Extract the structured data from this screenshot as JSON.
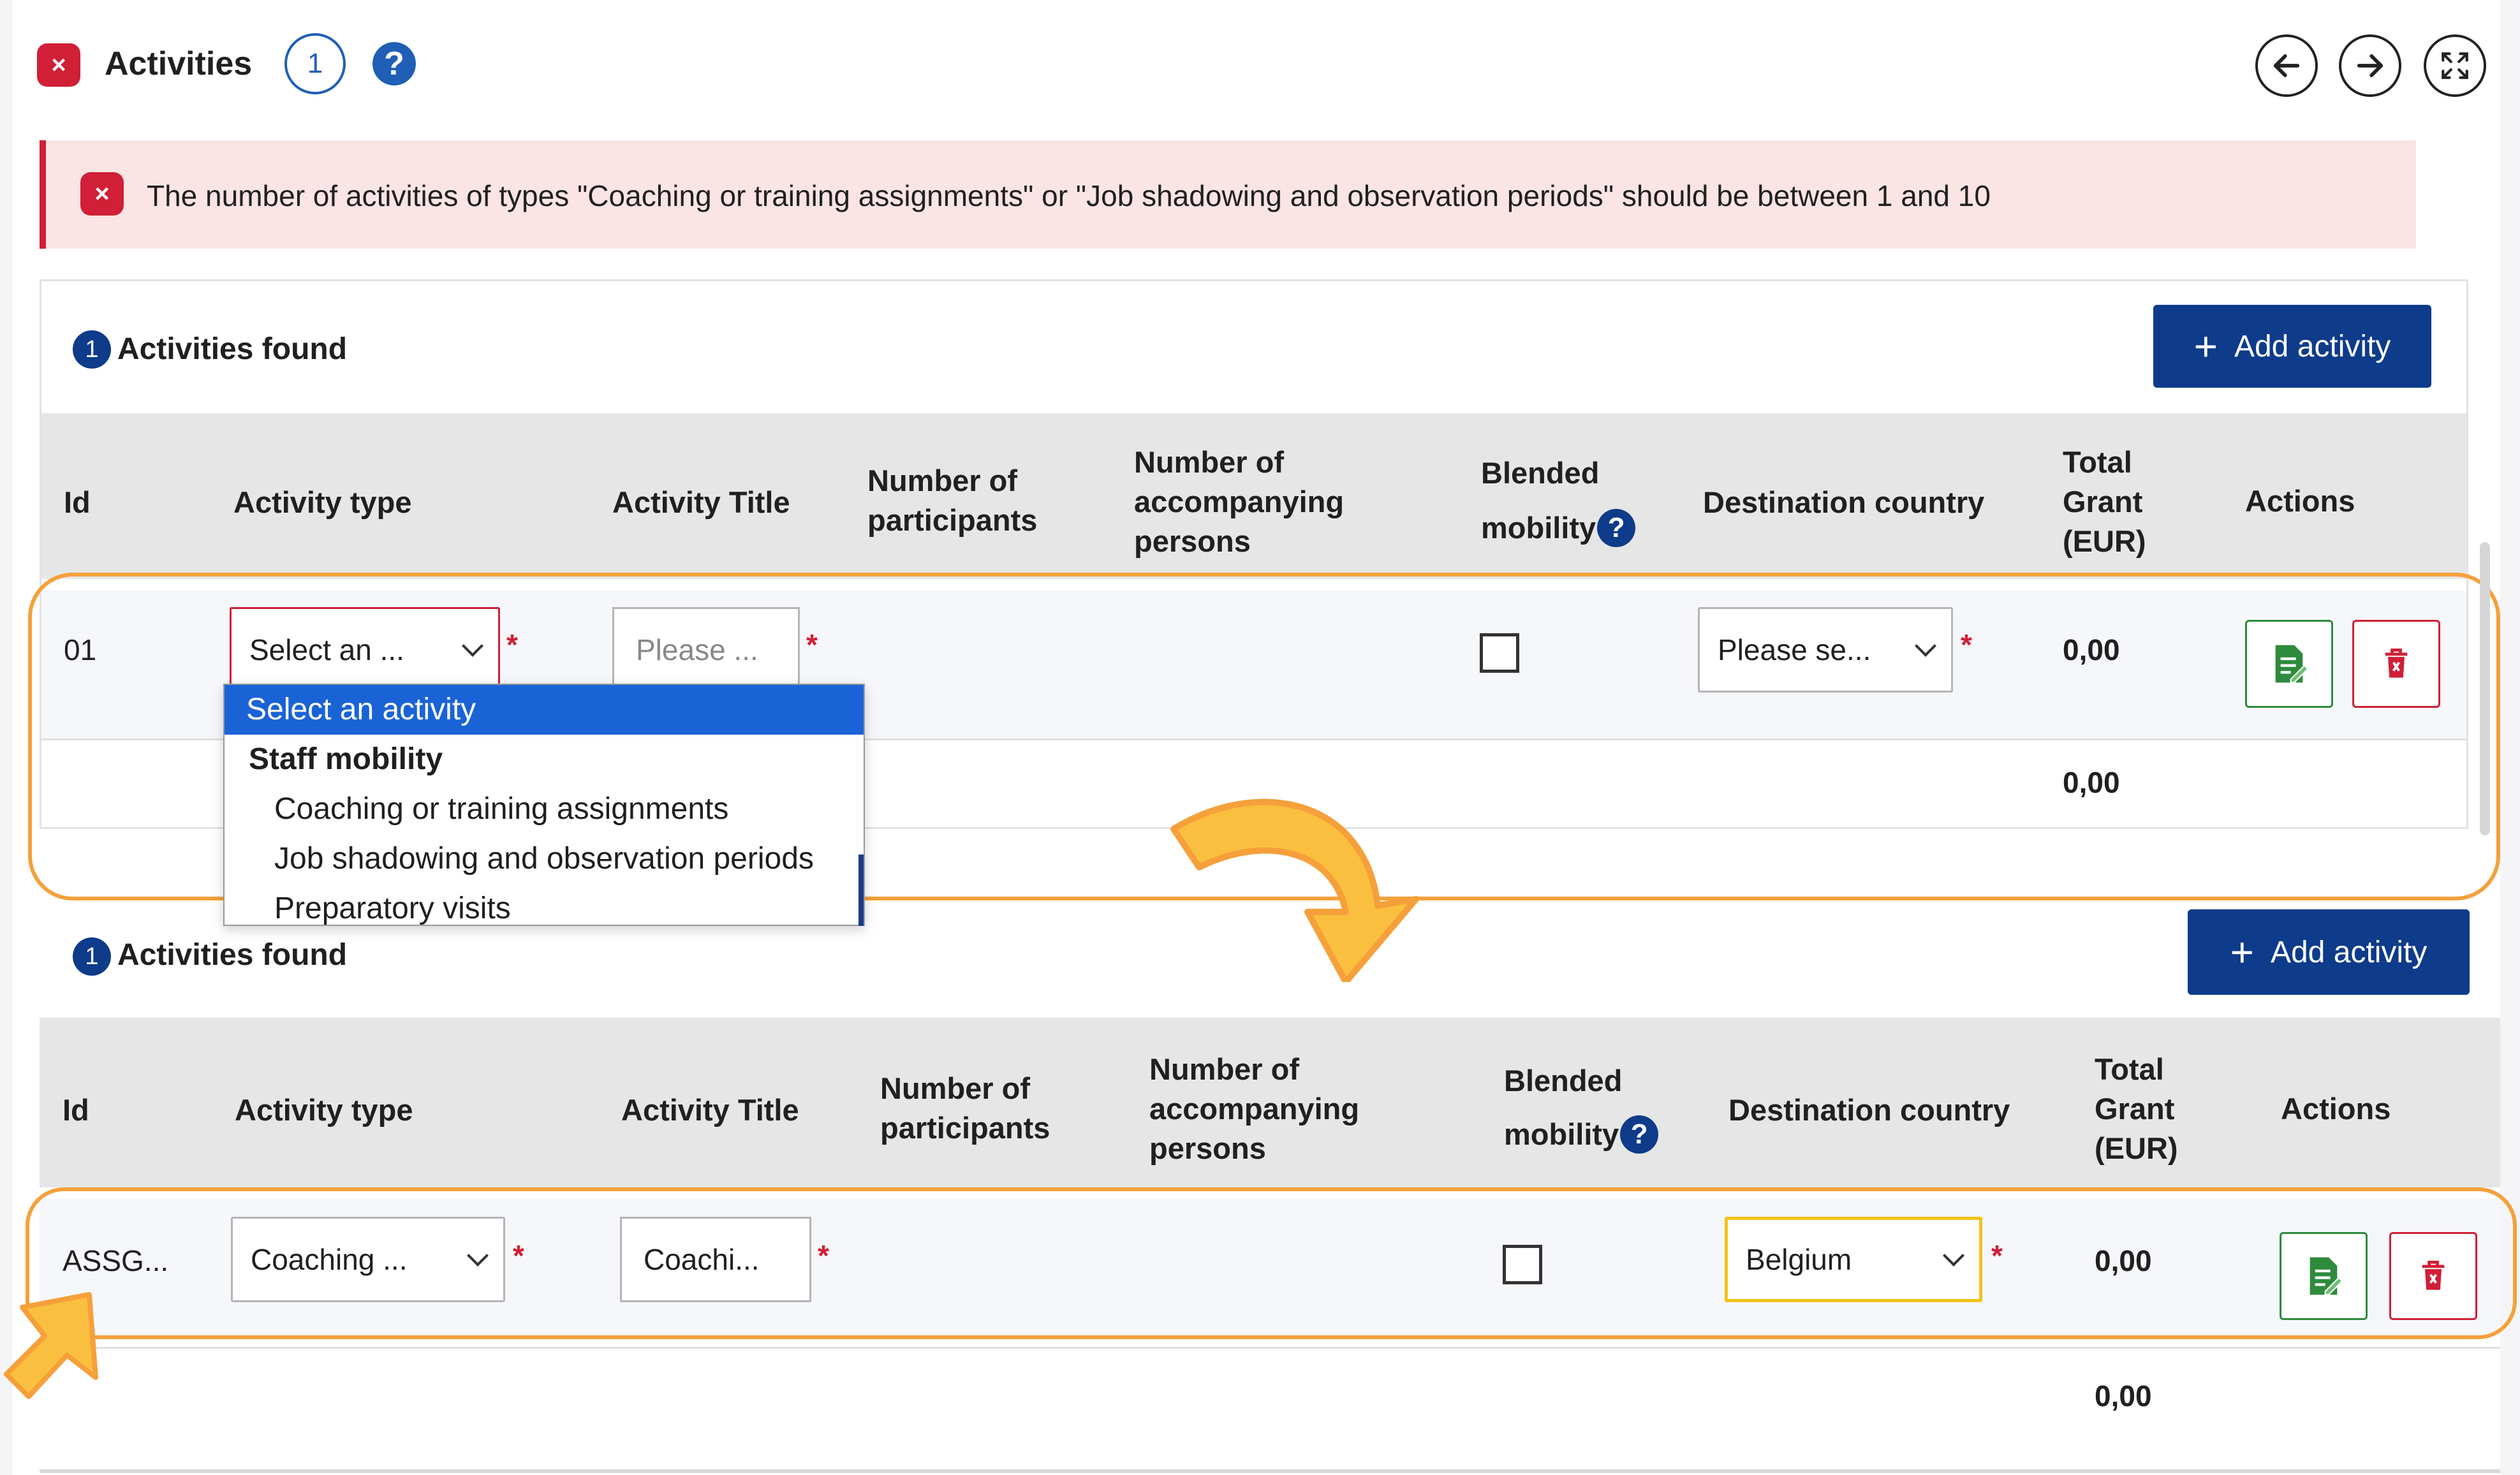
{
  "header": {
    "title": "Activities",
    "count": "1",
    "help": "?",
    "error_badge": "×"
  },
  "alert": {
    "text": "The number of activities of types \"Coaching or training assignments\" or \"Job shadowing and observation periods\" should be between 1 and 10"
  },
  "panel_top": {
    "found_count": "1",
    "found_label": "Activities found",
    "add_button": "Add activity",
    "columns": {
      "id": "Id",
      "activity_type": "Activity type",
      "activity_title": "Activity Title",
      "participants_1": "Number of",
      "participants_2": "participants",
      "accomp_1": "Number of",
      "accomp_2": "accompanying",
      "accomp_3": "persons",
      "blended_1": "Blended",
      "blended_2": "mobility",
      "destination": "Destination country",
      "grant_1": "Total",
      "grant_2": "Grant",
      "grant_3": "(EUR)",
      "actions": "Actions"
    },
    "row": {
      "id": "01",
      "activity_type": "Select an ...",
      "activity_title_placeholder": "Please ...",
      "destination": "Please se...",
      "grant": "0,00"
    },
    "total": "0,00",
    "dropdown": {
      "selected": "Select an activity",
      "group": "Staff mobility",
      "options": [
        "Coaching or training assignments",
        "Job shadowing and observation periods",
        "Preparatory visits"
      ]
    }
  },
  "panel_bottom": {
    "found_count": "1",
    "found_label": "Activities found",
    "add_button": "Add activity",
    "columns": {
      "id": "Id",
      "activity_type": "Activity type",
      "activity_title": "Activity Title",
      "participants_1": "Number of",
      "participants_2": "participants",
      "accomp_1": "Number of",
      "accomp_2": "accompanying",
      "accomp_3": "persons",
      "blended_1": "Blended",
      "blended_2": "mobility",
      "destination": "Destination country",
      "grant_1": "Total",
      "grant_2": "Grant",
      "grant_3": "(EUR)",
      "actions": "Actions"
    },
    "row": {
      "id": "ASSG...",
      "activity_type": "Coaching ...",
      "activity_title": "Coachi...",
      "destination": "Belgium",
      "grant": "0,00"
    },
    "total": "0,00"
  },
  "required_mark": "*",
  "icons": {
    "error": "error-x-icon",
    "help": "question-icon",
    "back": "arrow-left-icon",
    "forward": "arrow-right-icon",
    "fullscreen": "expand-icon",
    "add": "plus-icon",
    "edit": "edit-document-icon",
    "delete": "trash-icon"
  },
  "colors": {
    "brand_blue": "#0e3b8a",
    "error_red": "#d01f36",
    "alert_bg": "#fbe4e4",
    "highlight_orange": "#f5a03a",
    "dropdown_selected": "#1a63d6",
    "focus_yellow": "#f2c318"
  }
}
